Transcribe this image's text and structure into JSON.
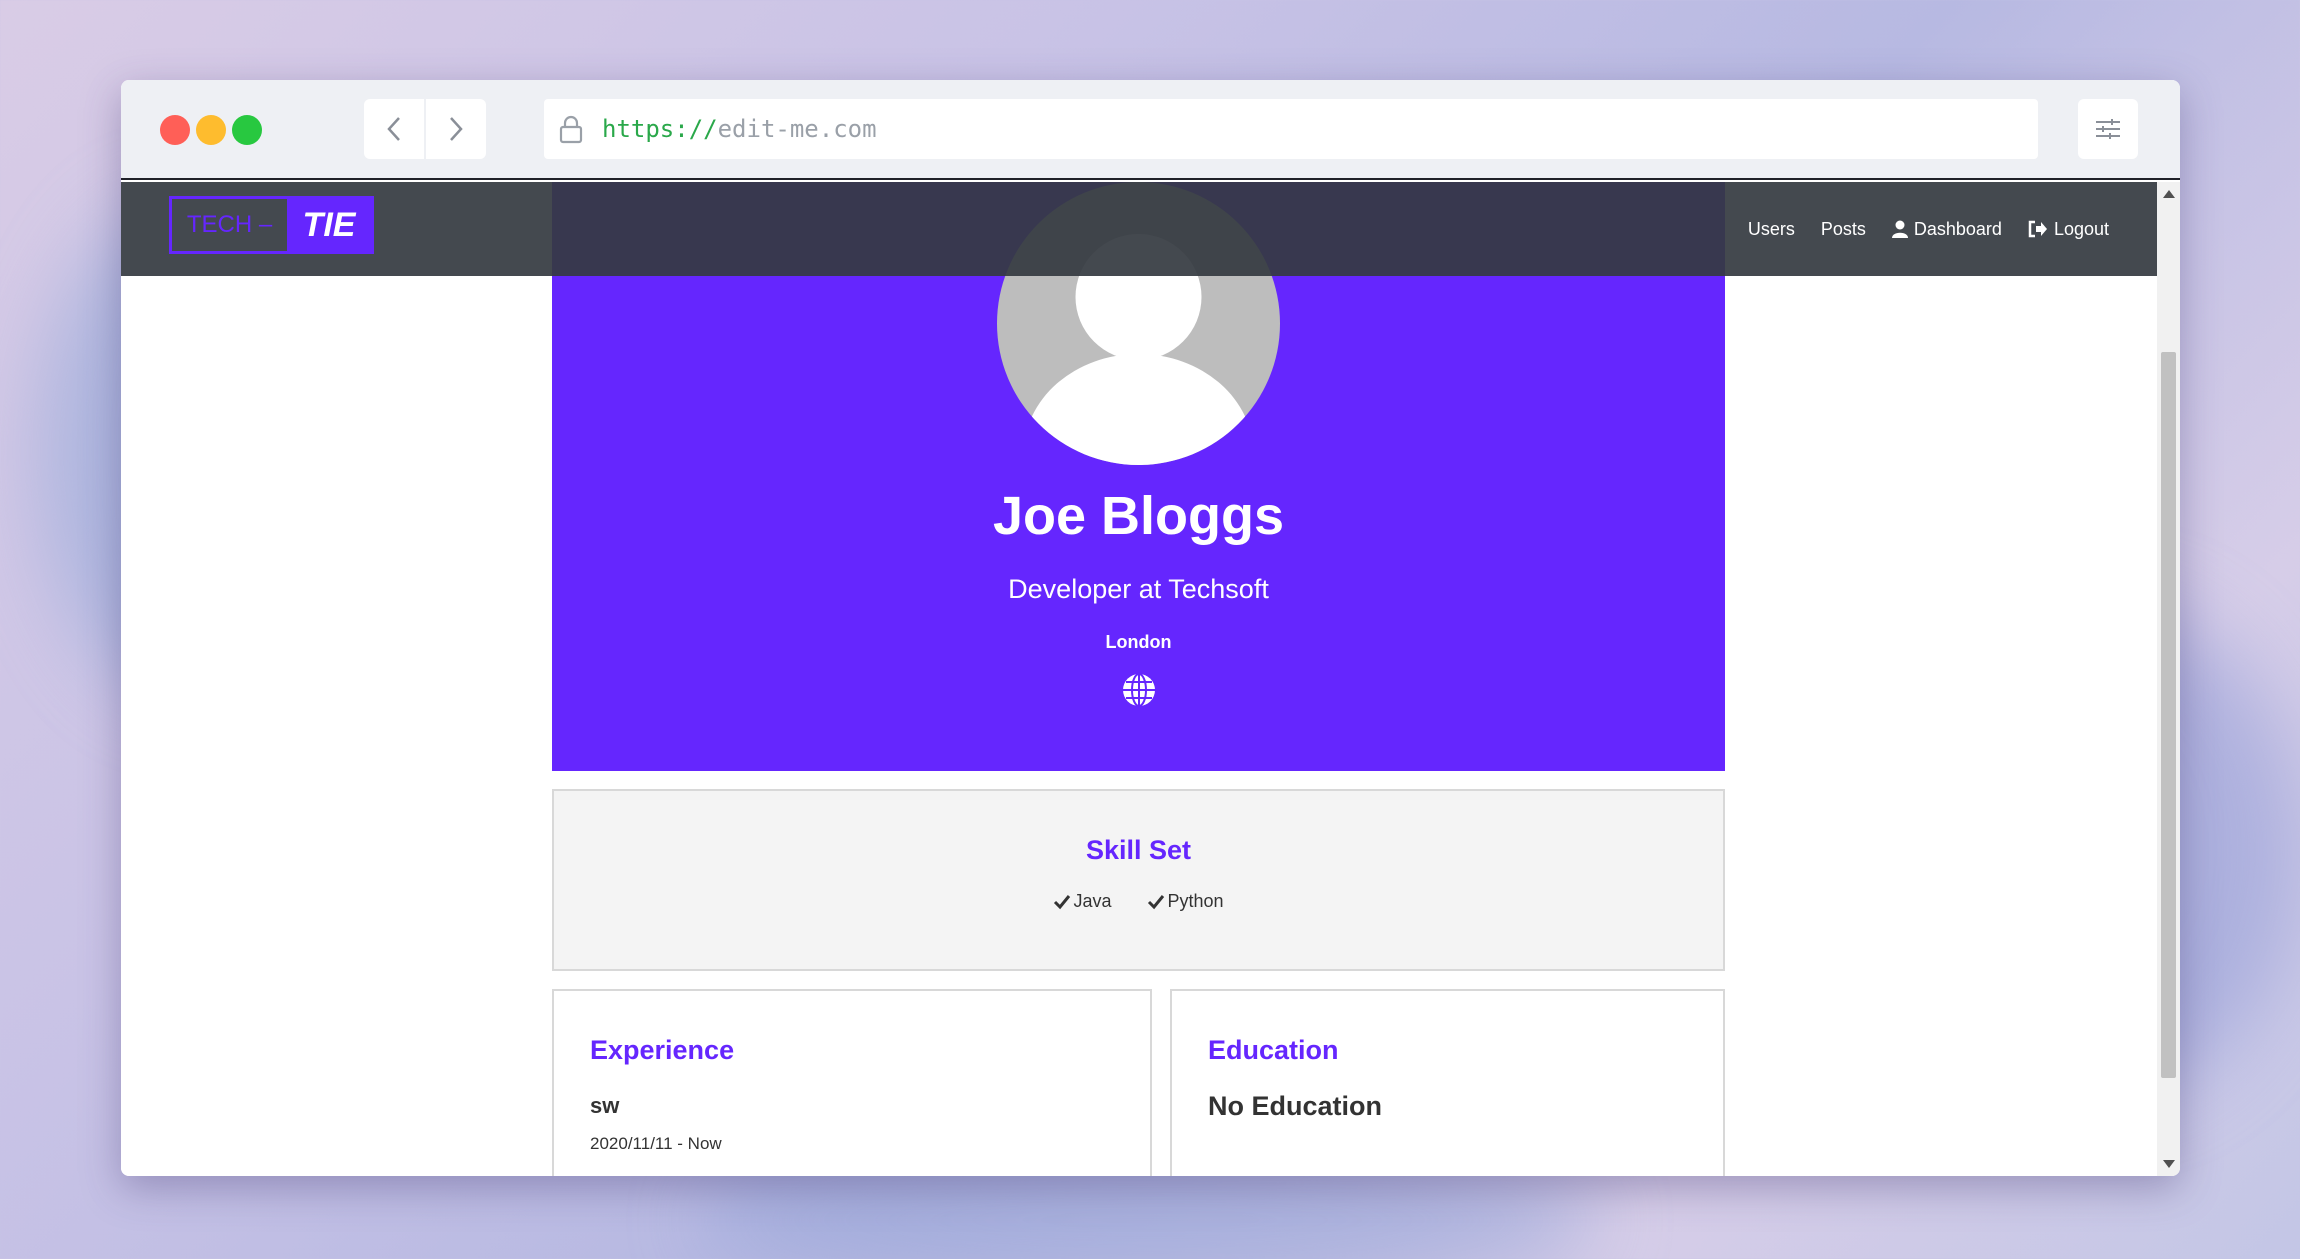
{
  "browser": {
    "url_scheme": "https://",
    "url_host": "edit-me.com"
  },
  "navbar": {
    "logo_left": "TECH –",
    "logo_right": "TIE",
    "items": [
      {
        "label": "Users",
        "icon": ""
      },
      {
        "label": "Posts",
        "icon": ""
      },
      {
        "label": "Dashboard",
        "icon": "user-icon"
      },
      {
        "label": "Logout",
        "icon": "sign-out-icon"
      }
    ]
  },
  "profile": {
    "name": "Joe Bloggs",
    "title": "Developer at Techsoft",
    "location": "London",
    "website_icon": "globe-icon"
  },
  "skills": {
    "heading": "Skill Set",
    "items": [
      "Java",
      "Python"
    ]
  },
  "experience": {
    "heading": "Experience",
    "company": "sw",
    "dates": "2020/11/11 - Now"
  },
  "education": {
    "heading": "Education",
    "empty_text": "No Education"
  },
  "colors": {
    "accent": "#6526fe",
    "navbar": "#343a40"
  }
}
